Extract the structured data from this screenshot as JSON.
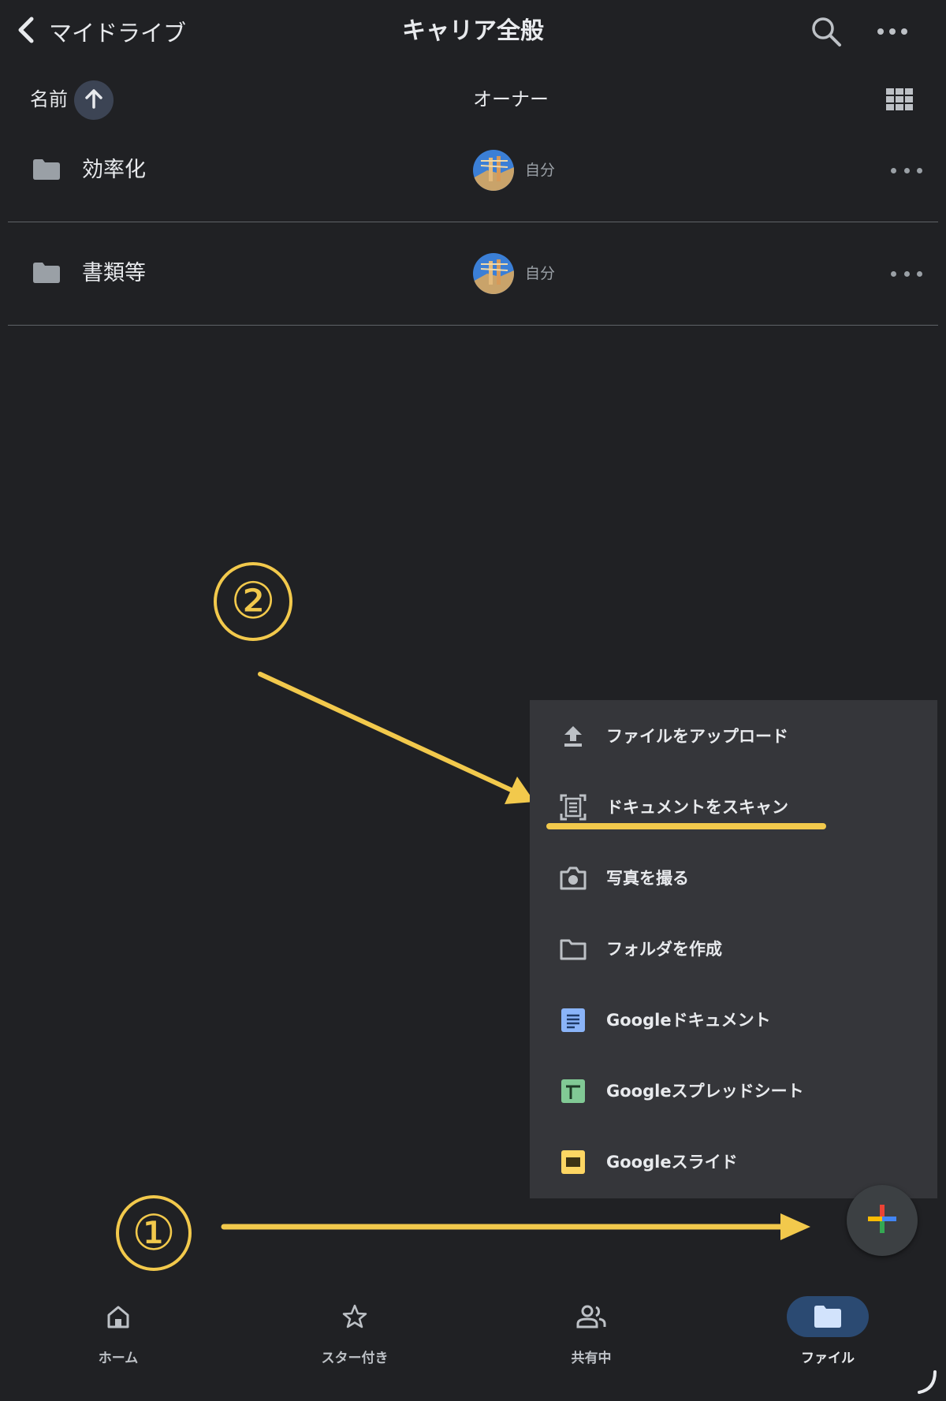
{
  "header": {
    "back_label": "マイドライブ",
    "title": "キャリア全般",
    "search_icon": "search-icon",
    "more_icon": "more-horizontal-icon"
  },
  "columns": {
    "name": "名前",
    "owner": "オーナー",
    "sort_icon": "arrow-up-icon",
    "view_icon": "grid-view-icon"
  },
  "files": [
    {
      "name": "効率化",
      "owner": "自分",
      "icon": "folder-icon"
    },
    {
      "name": "書類等",
      "owner": "自分",
      "icon": "folder-icon"
    }
  ],
  "menu": {
    "items": [
      {
        "label": "ファイルをアップロード",
        "icon": "upload-icon"
      },
      {
        "label": "ドキュメントをスキャン",
        "icon": "scan-document-icon"
      },
      {
        "label": "写真を撮る",
        "icon": "camera-icon"
      },
      {
        "label": "フォルダを作成",
        "icon": "folder-outline-icon"
      },
      {
        "label": "Googleドキュメント",
        "icon": "google-docs-icon"
      },
      {
        "label": "Googleスプレッドシート",
        "icon": "google-sheets-icon"
      },
      {
        "label": "Googleスライド",
        "icon": "google-slides-icon"
      }
    ]
  },
  "annotations": {
    "step1": "①",
    "step2": "②",
    "accent_color": "#f2c94c"
  },
  "bottom_nav": [
    {
      "label": "ホーム",
      "icon": "home-icon"
    },
    {
      "label": "スター付き",
      "icon": "star-icon"
    },
    {
      "label": "共有中",
      "icon": "people-icon"
    },
    {
      "label": "ファイル",
      "icon": "folder-filled-icon",
      "active": true
    }
  ],
  "colors": {
    "background": "#202124",
    "menu_background": "#35363a",
    "nav_active": "#2b4a72"
  }
}
